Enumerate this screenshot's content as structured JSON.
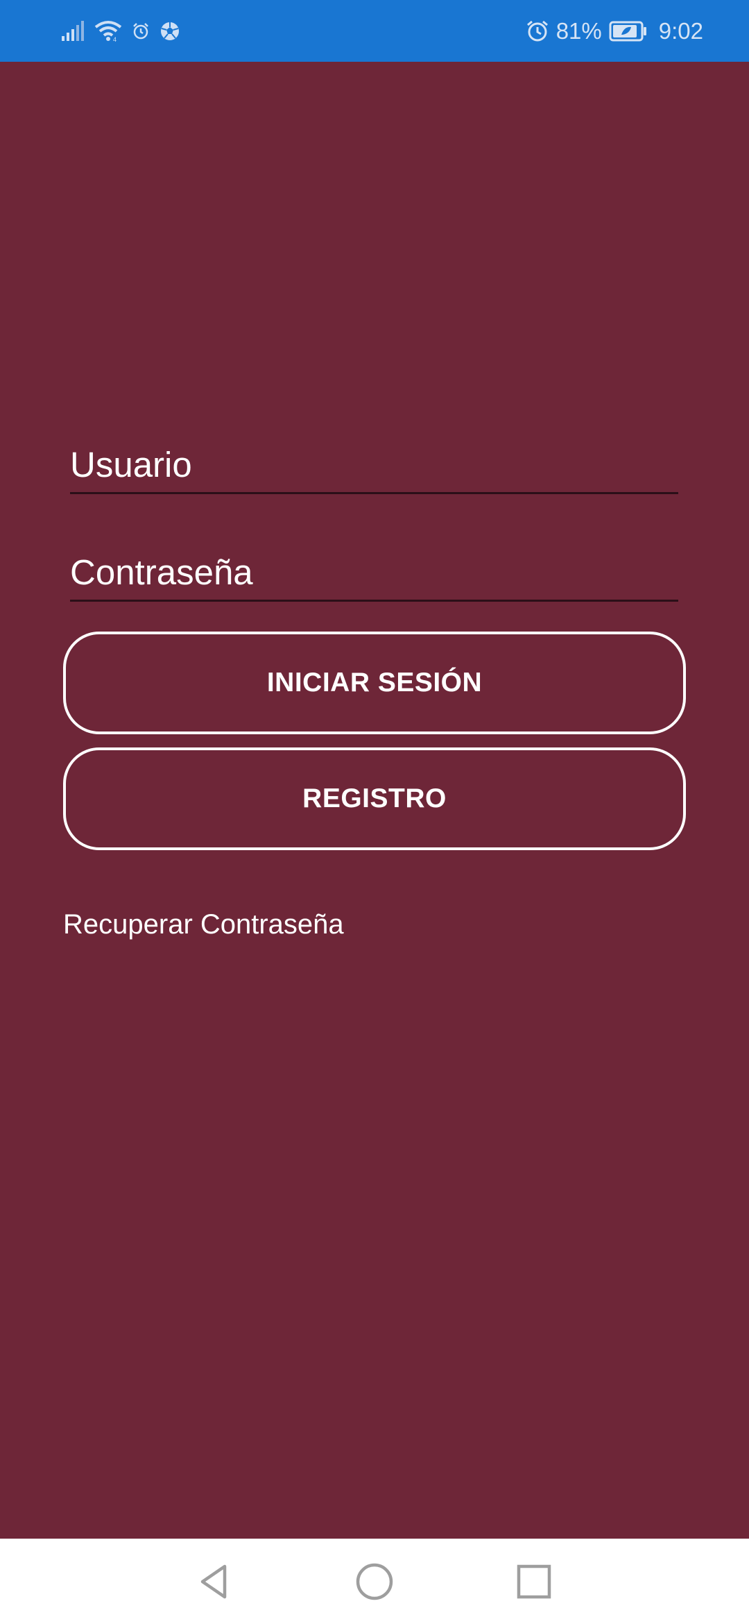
{
  "status_bar": {
    "icons_left": [
      "signal-icon",
      "wifi-icon",
      "alarm-small-icon",
      "soccer-ball-icon"
    ],
    "icons_right": [
      "alarm-icon",
      "battery-icon"
    ],
    "battery_percent": "81%",
    "time": "9:02"
  },
  "login_form": {
    "username_placeholder": "Usuario",
    "password_placeholder": "Contraseña",
    "login_label": "INICIAR SESIÓN",
    "register_label": "REGISTRO",
    "recover_label": "Recuperar Contraseña"
  },
  "nav_bar": {
    "buttons": [
      "back-icon",
      "home-icon",
      "recents-icon"
    ]
  },
  "colors": {
    "background": "#6e2638",
    "status_bar": "#1976d2",
    "text": "#ffffff",
    "nav_bar": "#ffffff"
  }
}
